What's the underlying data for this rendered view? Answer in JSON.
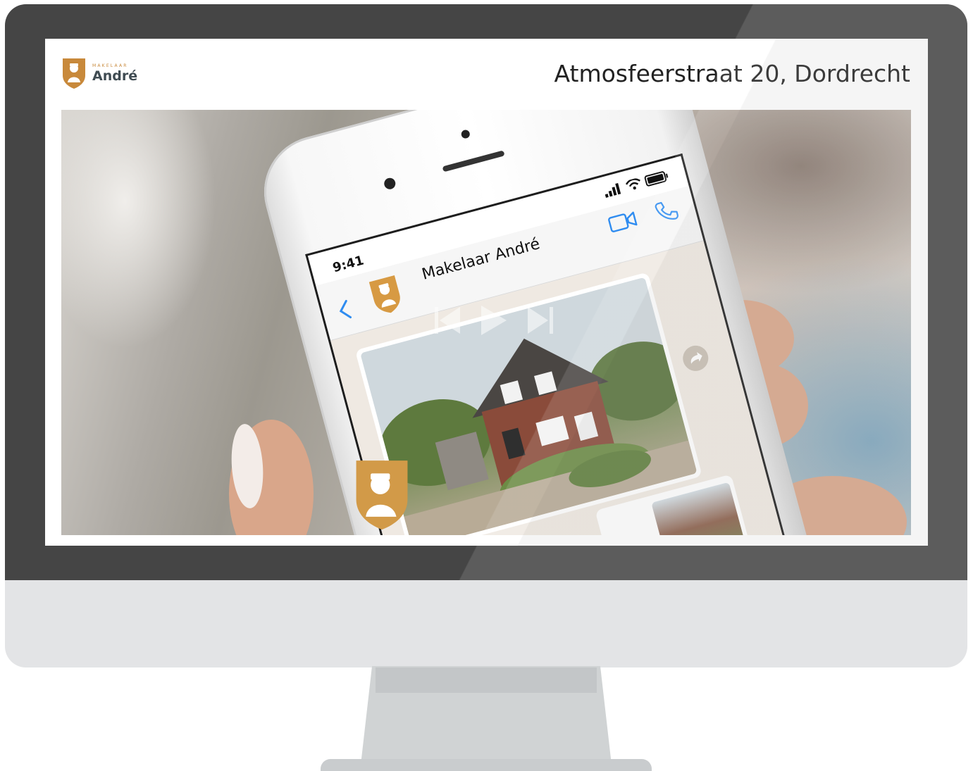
{
  "brand": {
    "small": "MAKELAAR",
    "name": "André"
  },
  "address": "Atmosfeerstraat 20, Dordrecht",
  "phone": {
    "status_time": "9:41",
    "chat_name": "Makelaar André"
  },
  "colors": {
    "bezel": "#454545",
    "monitor_chin": "#e3e4e6",
    "brand_gold": "#c8893b",
    "brand_text": "#3f4b52",
    "ios_blue": "#2f8cf0"
  },
  "icons": {
    "back": "chevron-left-icon",
    "video_call": "video-camera-icon",
    "phone_call": "phone-icon",
    "forward": "share-forward-icon",
    "skip_back": "skip-back-icon",
    "play": "play-icon",
    "skip_forward": "skip-forward-icon"
  }
}
